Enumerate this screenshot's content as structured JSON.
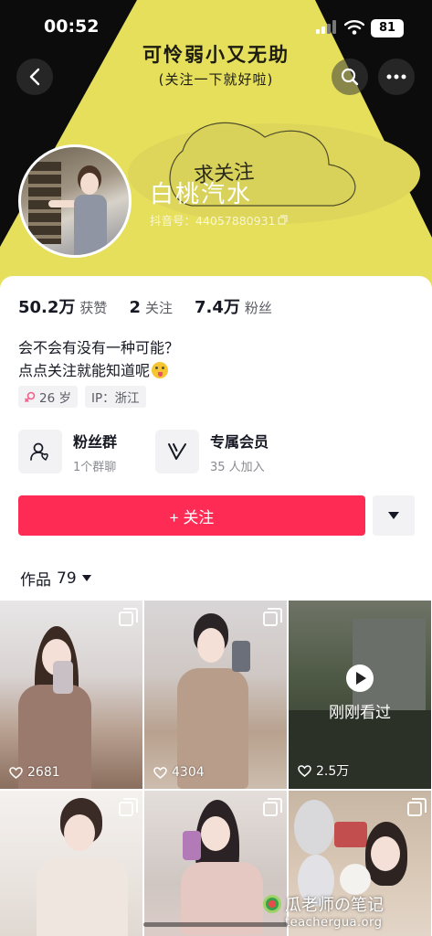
{
  "status_bar": {
    "time": "00:52",
    "battery": "81"
  },
  "banner": {
    "line1": "可怜弱小又无助",
    "line2": "(关注一下就好啦)",
    "sticker": "求关注",
    "colors": {
      "beam": "#e9e25e",
      "bg": "#0c0c0c"
    }
  },
  "profile": {
    "name": "白桃汽水",
    "douyin_id": "抖音号：44057880931"
  },
  "stats": [
    {
      "value": "50.2万",
      "label": "获赞"
    },
    {
      "value": "2",
      "label": "关注"
    },
    {
      "value": "7.4万",
      "label": "粉丝"
    }
  ],
  "bio": {
    "line1": "会不会有没有一种可能？",
    "line2": "点点关注就能知道呢"
  },
  "tags": {
    "age": "26 岁",
    "ip": "IP：浙江"
  },
  "services": {
    "fans_group": {
      "title": "粉丝群",
      "sub": "1个群聊"
    },
    "member": {
      "title": "专属会员",
      "sub": "35 人加入"
    }
  },
  "follow_button": "+ 关注",
  "works": {
    "label": "作品",
    "count": "79"
  },
  "grid": [
    {
      "likes": "2681"
    },
    {
      "likes": "4304"
    },
    {
      "likes": "2.5万",
      "overlay": "刚刚看过"
    },
    {},
    {},
    {}
  ],
  "watermark": {
    "line1": "瓜老师の笔记",
    "line2": "teachergua.org"
  },
  "accent_color": "#fe2c55"
}
